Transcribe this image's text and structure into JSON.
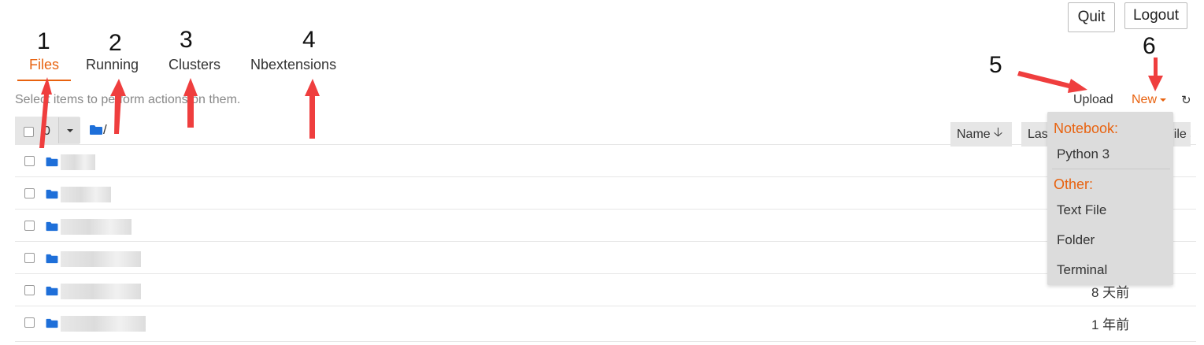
{
  "header": {
    "quit_label": "Quit",
    "logout_label": "Logout"
  },
  "tabs": [
    {
      "label": "Files",
      "active": true
    },
    {
      "label": "Running",
      "active": false
    },
    {
      "label": "Clusters",
      "active": false
    },
    {
      "label": "Nbextensions",
      "active": false
    }
  ],
  "annotations": [
    "1",
    "2",
    "3",
    "4",
    "5",
    "6"
  ],
  "toolbar": {
    "hint": "Select items to perform actions on them.",
    "upload_label": "Upload",
    "new_label": "New",
    "refresh_icon": "refresh-icon"
  },
  "listing": {
    "selected_count": "0",
    "path": "/",
    "sort_name_label": "Name",
    "sort_lastmod_label": "Last Modified",
    "sort_size_label": "File size",
    "rows": [
      {
        "type": "folder",
        "modified": ""
      },
      {
        "type": "folder",
        "modified": ""
      },
      {
        "type": "folder",
        "modified": ""
      },
      {
        "type": "folder",
        "modified": ""
      },
      {
        "type": "folder",
        "modified": "8 天前"
      },
      {
        "type": "folder",
        "modified": "1 年前"
      }
    ]
  },
  "new_menu": {
    "notebook_header": "Notebook:",
    "python_label": "Python 3",
    "other_header": "Other:",
    "text_file_label": "Text File",
    "folder_label": "Folder",
    "terminal_label": "Terminal"
  },
  "colors": {
    "accent": "#e8620f",
    "folder": "#1e6fd9",
    "arrow": "#ef3e3e"
  }
}
